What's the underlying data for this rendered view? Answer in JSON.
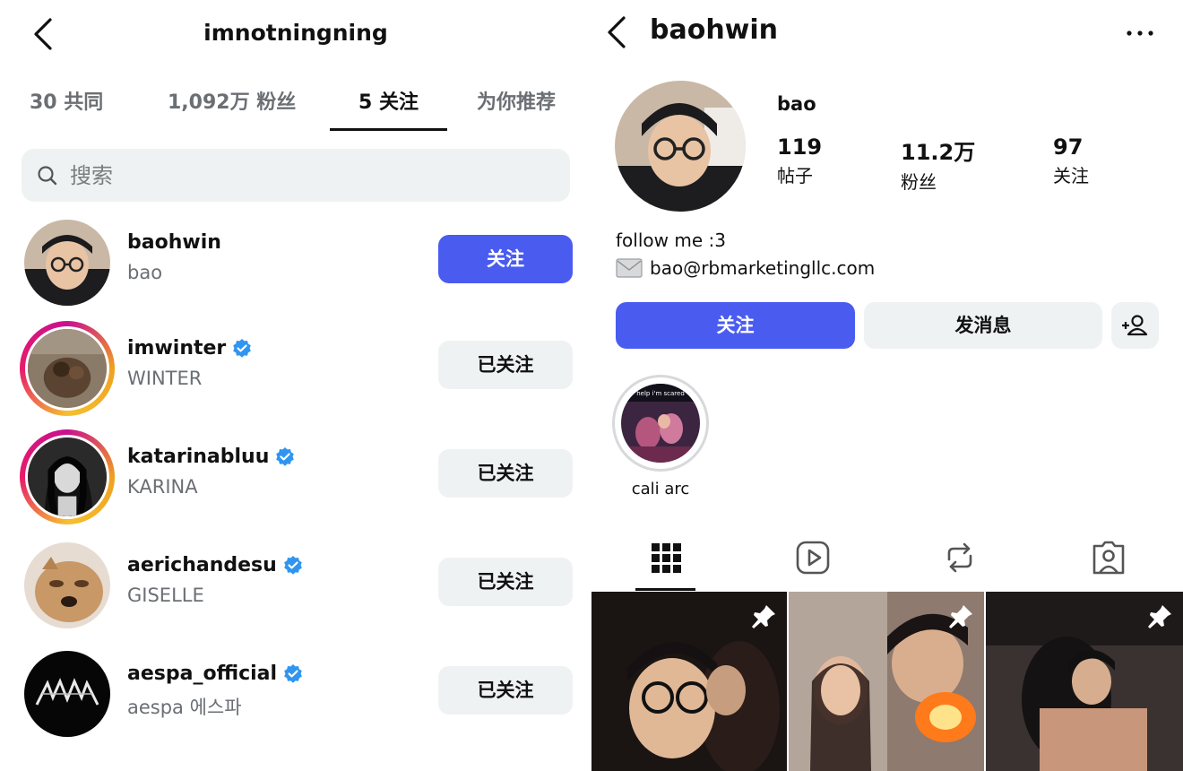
{
  "left": {
    "title": "imnotningning",
    "tabs": [
      {
        "label": "30 共同"
      },
      {
        "label": "1,092万 粉丝"
      },
      {
        "label": "5 关注"
      },
      {
        "label": "为你推荐"
      }
    ],
    "search": {
      "placeholder": "搜索"
    },
    "users": [
      {
        "handle": "baohwin",
        "name": "bao",
        "verified": false,
        "button": "关注",
        "button_style": "follow"
      },
      {
        "handle": "imwinter",
        "name": "WINTER",
        "verified": true,
        "button": "已关注",
        "button_style": "following"
      },
      {
        "handle": "katarinabluu",
        "name": "KARINA",
        "verified": true,
        "button": "已关注",
        "button_style": "following"
      },
      {
        "handle": "aerichandesu",
        "name": "GISELLE",
        "verified": true,
        "button": "已关注",
        "button_style": "following"
      },
      {
        "handle": "aespa_official",
        "name": "aespa 에스파",
        "verified": true,
        "button": "已关注",
        "button_style": "following"
      }
    ]
  },
  "right": {
    "title": "baohwin",
    "name": "bao",
    "stats": [
      {
        "num": "119",
        "label": "帖子"
      },
      {
        "num": "11.2万",
        "label": "粉丝"
      },
      {
        "num": "97",
        "label": "关注"
      }
    ],
    "bio": "follow me :3",
    "email": "bao@rbmarketingllc.com",
    "buttons": {
      "follow": "关注",
      "message": "发消息"
    },
    "highlight": {
      "label": "cali arc",
      "caption": "help i'm scared"
    }
  },
  "colors": {
    "accent": "#4a5cf0",
    "button_grey": "#eff2f3",
    "verified": "#2f95f0",
    "secondary_text": "#6b6f74"
  },
  "icons": [
    "back-chevron-icon",
    "search-icon",
    "verified-badge-icon",
    "more-icon",
    "add-person-icon",
    "mail-icon",
    "grid-icon",
    "reels-icon",
    "reposts-icon",
    "tagged-icon",
    "pin-icon"
  ]
}
